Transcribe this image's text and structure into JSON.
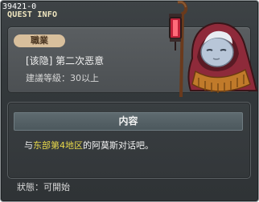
{
  "quest": {
    "id": "39421-0",
    "header_title": "QUEST INFO",
    "job_label": "職業",
    "name": "[该隐] 第二次恶意",
    "required_level": "建議等級：30以上"
  },
  "content": {
    "header": "内容",
    "text_before": "与",
    "text_highlight": "东部第4地区",
    "text_after": "的阿莫斯对话吧。"
  },
  "status": {
    "text": "狀態：可開始"
  },
  "npc": {
    "icon": "hooded-npc-with-lantern-icon"
  },
  "colors": {
    "highlight": "#e8d84a",
    "badge": "#d8bf9c",
    "window_bg": "#33383b"
  }
}
